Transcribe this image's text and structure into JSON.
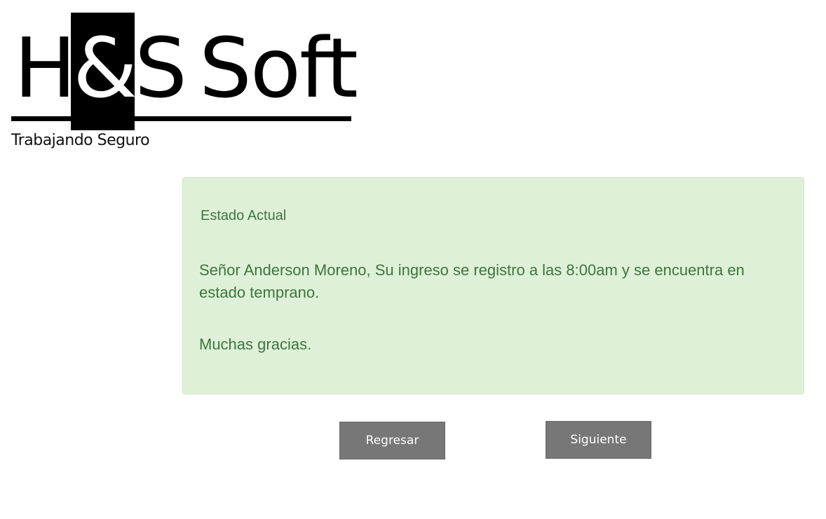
{
  "logo": {
    "letter_h": "H",
    "ampersand": "&",
    "letter_s": "S",
    "soft": "Soft",
    "tagline": "Trabajando Seguro"
  },
  "alert": {
    "title": "Estado Actual",
    "message": "Señor Anderson Moreno, Su ingreso se registro a las 8:00am y se encuentra en estado temprano.",
    "thanks": "Muchas gracias."
  },
  "buttons": {
    "back_label": "Regresar",
    "next_label": "Siguiente"
  },
  "colors": {
    "alert_background": "#dff0d8",
    "alert_text": "#3c763d",
    "button_background": "#777777"
  }
}
